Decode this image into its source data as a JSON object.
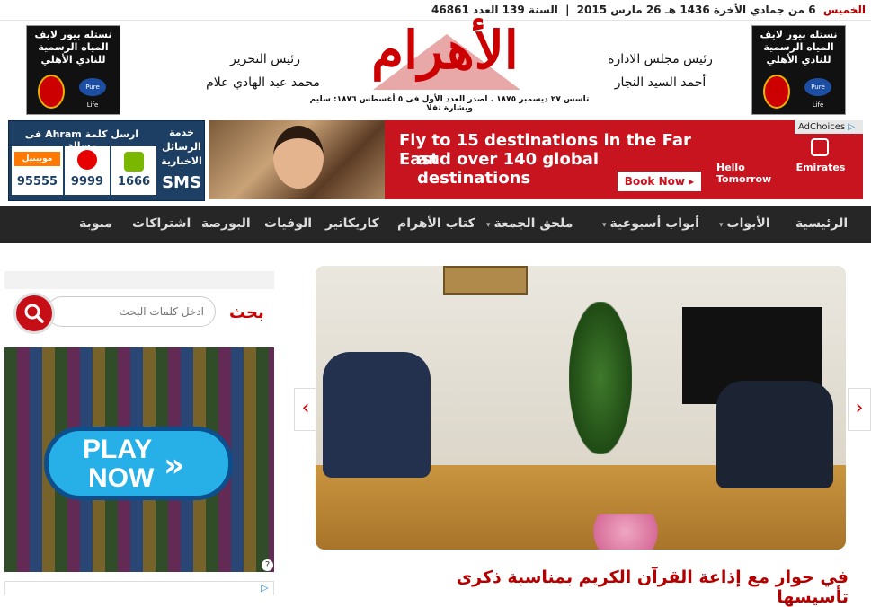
{
  "date_bar": {
    "day": "الخميس",
    "date": "6 من جمادي الأخرة 1436 هـ 26 مارس 2015",
    "separator": "|",
    "year_issue": "السنة 139 العدد 46861"
  },
  "header": {
    "ad_left": {
      "line1": "نستله بيور لايف",
      "line2": "المياه الرسمية",
      "line3": "للنادي الأهلي",
      "brand": "Pure Life"
    },
    "ad_right": {
      "line1": "نستله بيور لايف",
      "line2": "المياه الرسمية",
      "line3": "للنادي الأهلي",
      "brand": "Pure Life"
    },
    "masthead": "الأهرام",
    "masthead_sub": "تاسس ٢٧ ديسمبر ١٨٧٥ . اصدر العدد الأول فى ٥ أغسطس ١٨٧٦: سليم وبشارة تقلا",
    "board_title": "رئيس مجلس الادارة",
    "board_name": "أحمد السيد النجار",
    "editor_title": "رئيس التحرير",
    "editor_name": "محمد عبد الهادي علام"
  },
  "sms_box": {
    "send_text": "ارسل كلمة Ahram فى رسالة",
    "service_line1": "خدمة",
    "service_line2": "الرسائل",
    "service_line3": "الاخبارية",
    "sms": "SMS",
    "operators": [
      {
        "name": "اتصالات",
        "number": "1666",
        "color": "#7ab800"
      },
      {
        "name": "vodafone",
        "number": "9999",
        "color": "#e60000"
      },
      {
        "name": "موبينيل",
        "number": "95555",
        "color": "#ff7900"
      }
    ]
  },
  "banner_ad": {
    "adchoices": "AdChoices",
    "headline_line1": "Fly to 15 destinations in the Far East",
    "headline_line2": "and over 140 global destinations",
    "cta": "Book Now",
    "tagline": "Hello Tomorrow",
    "brand": "Emirates"
  },
  "nav": {
    "items": [
      {
        "label": "الرئيسية",
        "dropdown": false
      },
      {
        "label": "الأبواب",
        "dropdown": true
      },
      {
        "label": "أبواب أسبوعية",
        "dropdown": true
      },
      {
        "label": "ملحق الجمعة",
        "dropdown": true
      },
      {
        "label": "كتاب الأهرام",
        "dropdown": false
      },
      {
        "label": "كاريكاتير",
        "dropdown": false
      },
      {
        "label": "الوفيات",
        "dropdown": false
      },
      {
        "label": "البورصة",
        "dropdown": false
      },
      {
        "label": "اشتراكات",
        "dropdown": false
      },
      {
        "label": "مبوبة",
        "dropdown": false
      }
    ]
  },
  "sidebar": {
    "search_title": "بحث",
    "search_placeholder": "ادخل كلمات البحث",
    "game_ad": {
      "line1": "PLAY",
      "line2": "NOW",
      "info": "?"
    }
  },
  "main": {
    "headline": "في حوار مع إذاعة القرآن الكريم بمناسبة ذكرى تأسيسها",
    "prev_arrow": "‹",
    "next_arrow": "›"
  }
}
